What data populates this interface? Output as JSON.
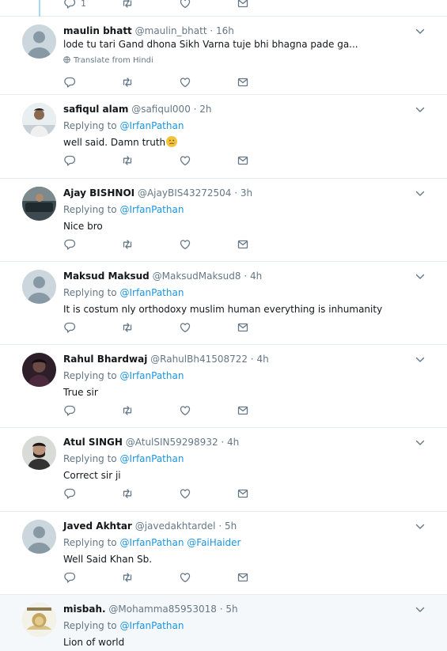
{
  "top_partial": {
    "reply_count": "1"
  },
  "tweets": [
    {
      "name": "maulin bhatt",
      "handle": "@maulin_bhatt",
      "time": "· 16h",
      "replying_prefix": "",
      "mentions": [],
      "text": "lode tu tari Gand dhona Sikh Varna tuje bhi bhagna pade ga...",
      "translate": "Translate from Hindi",
      "avatar": "default"
    },
    {
      "name": "safiqul alam",
      "handle": "@safiqul000",
      "time": "· 2h",
      "replying_prefix": "Replying to",
      "mentions": [
        "@IrfanPathan"
      ],
      "text": "well said. Damn truth",
      "avatar": "photo-man"
    },
    {
      "name": "Ajay BISHNOI",
      "handle": "@AjayBIS43272504",
      "time": "· 3h",
      "replying_prefix": "Replying to",
      "mentions": [
        "@IrfanPathan"
      ],
      "text": "Nice bro",
      "avatar": "photo-car"
    },
    {
      "name": "Maksud Maksud",
      "handle": "@MaksudMaksud8",
      "time": "· 4h",
      "replying_prefix": "Replying to",
      "mentions": [
        "@IrfanPathan"
      ],
      "text": "It is costum nly orthodoxy muslim human everything is inhumanity",
      "avatar": "default"
    },
    {
      "name": "Rahul Bhardwaj",
      "handle": "@RahulBh41508722",
      "time": "· 4h",
      "replying_prefix": "Replying to",
      "mentions": [
        "@IrfanPathan"
      ],
      "text": "True sir",
      "avatar": "photo-dark"
    },
    {
      "name": "Atul SINGH",
      "handle": "@AtulSIN59298932",
      "time": "· 4h",
      "replying_prefix": "Replying to",
      "mentions": [
        "@IrfanPathan"
      ],
      "text": "Correct sir ji",
      "avatar": "photo-beard"
    },
    {
      "name": "Javed Akhtar",
      "handle": "@javedakhtardel",
      "time": "· 5h",
      "replying_prefix": "Replying to",
      "mentions": [
        "@IrfanPathan",
        "@FaiHaider"
      ],
      "text": "Well Said Khan Sb.",
      "avatar": "default"
    },
    {
      "name": "misbah.",
      "handle": "@Mohamma85953018",
      "time": "· 5h",
      "replying_prefix": "Replying to",
      "mentions": [
        "@IrfanPathan"
      ],
      "text": "Lion of world",
      "avatar": "photo-lion"
    }
  ],
  "icons": {
    "reply": "reply-icon",
    "retweet": "retweet-icon",
    "like": "heart-icon",
    "dm": "envelope-icon",
    "more": "chevron-down-icon",
    "translate": "globe-icon"
  },
  "colors": {
    "link": "#1b95e0",
    "muted": "#657786",
    "divider": "#e6ecf0",
    "thread": "#a4d9f5",
    "highlight_bg": "#f5f8fa"
  }
}
